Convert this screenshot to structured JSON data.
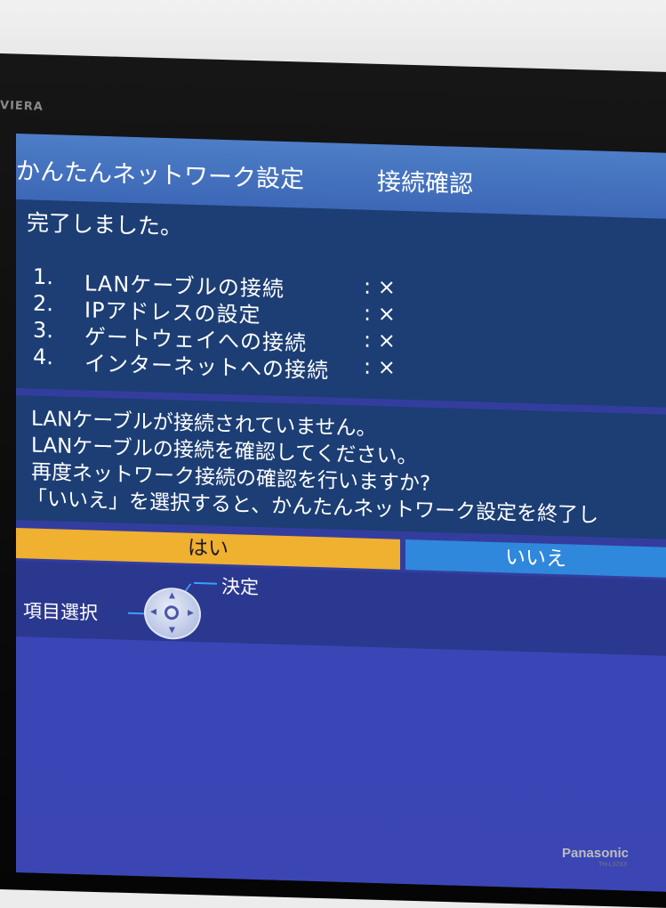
{
  "tv": {
    "brand_top": "VIERA",
    "brand_bottom": "Panasonic",
    "model": "TH-L32X3"
  },
  "dialog": {
    "title": "かんたんネットワーク設定",
    "subtitle": "接続確認",
    "status": "完了しました。",
    "checks": [
      {
        "num": "1.",
        "label": "LANケーブルの接続",
        "result": ": ×"
      },
      {
        "num": "2.",
        "label": "IPアドレスの設定",
        "result": ": ×"
      },
      {
        "num": "3.",
        "label": "ゲートウェイへの接続",
        "result": ": ×"
      },
      {
        "num": "4.",
        "label": "インターネットへの接続",
        "result": ": ×"
      }
    ],
    "messages": [
      "LANケーブルが接続されていません。",
      "LANケーブルの接続を確認してください。",
      "再度ネットワーク接続の確認を行いますか?",
      "「いいえ」を選択すると、かんたんネットワーク設定を終了し"
    ],
    "buttons": {
      "yes": "はい",
      "no": "いいえ"
    },
    "guide": {
      "select": "項目選択",
      "confirm": "決定"
    }
  },
  "colors": {
    "selected_button": "#f0b030",
    "unselected_button": "#2f88dc",
    "panel": "#1c3e74",
    "screen_background": "#333d9e"
  },
  "icons": [
    "dpad-icon"
  ]
}
